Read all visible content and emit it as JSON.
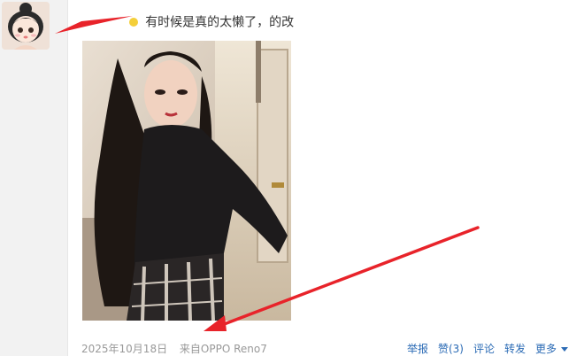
{
  "post": {
    "author_name": "██ ██",
    "text": "有时候是真的太懒了，的改",
    "date": "2025年10月18日",
    "source": "来自OPPO Reno7"
  },
  "actions": {
    "report": "举报",
    "like": "赞(3)",
    "comment": "评论",
    "repost": "转发",
    "more": "更多"
  },
  "colors": {
    "link": "#2b6bb5",
    "annotation": "#e8232a",
    "meta_text": "#999999"
  },
  "icons": [
    "avatar-cartoon",
    "chevron-down-icon",
    "smile-emoji-icon"
  ]
}
